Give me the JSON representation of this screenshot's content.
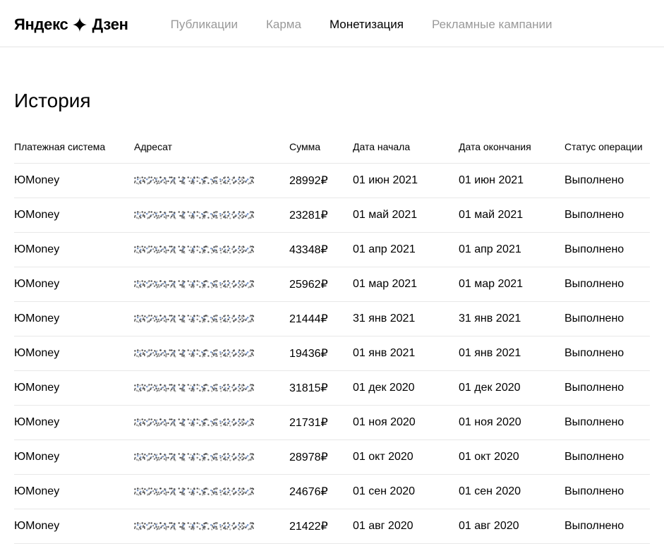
{
  "logo": {
    "brand": "Яндекс",
    "product": "Дзен"
  },
  "nav": {
    "items": [
      {
        "label": "Публикации",
        "active": false
      },
      {
        "label": "Карма",
        "active": false
      },
      {
        "label": "Монетизация",
        "active": true
      },
      {
        "label": "Рекламные кампании",
        "active": false
      }
    ]
  },
  "page": {
    "title": "История"
  },
  "table": {
    "headers": {
      "system": "Платежная система",
      "recipient": "Адресат",
      "amount": "Сумма",
      "start": "Дата начала",
      "end": "Дата окончания",
      "status": "Статус операции"
    },
    "currency": "₽",
    "rows": [
      {
        "system": "ЮMoney",
        "amount": "28992",
        "start": "01 июн 2021",
        "end": "01 июн 2021",
        "status": "Выполнено"
      },
      {
        "system": "ЮMoney",
        "amount": "23281",
        "start": "01 май 2021",
        "end": "01 май 2021",
        "status": "Выполнено"
      },
      {
        "system": "ЮMoney",
        "amount": "43348",
        "start": "01 апр 2021",
        "end": "01 апр 2021",
        "status": "Выполнено"
      },
      {
        "system": "ЮMoney",
        "amount": "25962",
        "start": "01 мар 2021",
        "end": "01 мар 2021",
        "status": "Выполнено"
      },
      {
        "system": "ЮMoney",
        "amount": "21444",
        "start": "31 янв 2021",
        "end": "31 янв 2021",
        "status": "Выполнено"
      },
      {
        "system": "ЮMoney",
        "amount": "19436",
        "start": "01 янв 2021",
        "end": "01 янв 2021",
        "status": "Выполнено"
      },
      {
        "system": "ЮMoney",
        "amount": "31815",
        "start": "01 дек 2020",
        "end": "01 дек 2020",
        "status": "Выполнено"
      },
      {
        "system": "ЮMoney",
        "amount": "21731",
        "start": "01 ноя 2020",
        "end": "01 ноя 2020",
        "status": "Выполнено"
      },
      {
        "system": "ЮMoney",
        "amount": "28978",
        "start": "01 окт 2020",
        "end": "01 окт 2020",
        "status": "Выполнено"
      },
      {
        "system": "ЮMoney",
        "amount": "24676",
        "start": "01 сен 2020",
        "end": "01 сен 2020",
        "status": "Выполнено"
      },
      {
        "system": "ЮMoney",
        "amount": "21422",
        "start": "01 авг 2020",
        "end": "01 авг 2020",
        "status": "Выполнено"
      }
    ]
  }
}
